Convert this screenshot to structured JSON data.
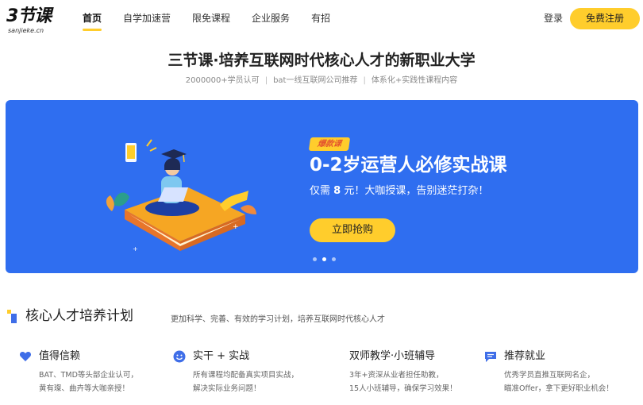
{
  "header": {
    "logo_text": "3节课",
    "logo_domain": "sanjieke.cn",
    "nav": [
      {
        "label": "首页",
        "active": true
      },
      {
        "label": "自学加速营",
        "active": false
      },
      {
        "label": "限免课程",
        "active": false
      },
      {
        "label": "企业服务",
        "active": false
      },
      {
        "label": "有招",
        "active": false
      }
    ],
    "login_label": "登录",
    "register_label": "免费注册"
  },
  "hero": {
    "title": "三节课·培养互联网时代核心人才的新职业大学",
    "subtitle_items": [
      "2000000+学员认可",
      "bat一线互联网公司推荐",
      "体系化+实践性课程内容"
    ]
  },
  "banner": {
    "badge": "爆款课",
    "title": "0-2岁运营人必修实战课",
    "desc_prefix": "仅需 ",
    "desc_price": "8",
    "desc_suffix": " 元！大咖授课，告别迷茫打杂！",
    "button_label": "立即抢购",
    "slide_count": 3,
    "active_slide": 2
  },
  "core": {
    "title": "核心人才培养计划",
    "desc": "更加科学、完善、有效的学习计划，培养互联网时代核心人才",
    "features": [
      {
        "icon": "heart-icon",
        "title": "值得信赖",
        "lines": [
          "BAT、TMD等头部企业认可，",
          "黄有璨、曲卉等大咖亲授！"
        ]
      },
      {
        "icon": "smile-icon",
        "title": "实干 + 实战",
        "lines": [
          "所有课程均配备真实项目实战，",
          "解决实际业务问题！"
        ]
      },
      {
        "icon": "",
        "title": "双师教学·小班辅导",
        "lines": [
          "3年+资深从业者担任助教，",
          "15人小班辅导，确保学习效果！"
        ]
      },
      {
        "icon": "chat-icon",
        "title": "推荐就业",
        "lines": [
          "优秀学员直推互联网名企，",
          "瞄准Offer，拿下更好职业机会！"
        ]
      }
    ]
  },
  "colors": {
    "accent_yellow": "#ffcd2c",
    "banner_blue": "#2f6ef0",
    "icon_blue": "#3f6ee8"
  }
}
